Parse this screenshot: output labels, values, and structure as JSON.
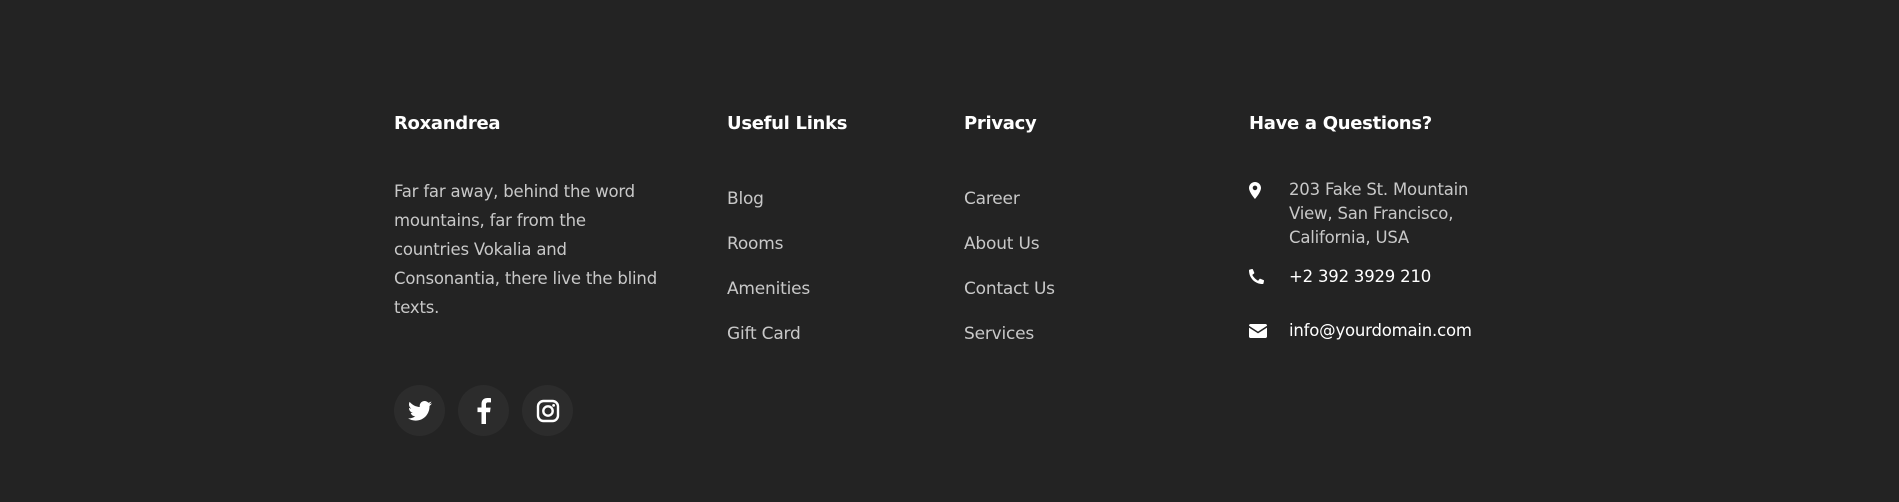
{
  "about": {
    "title": "Roxandrea",
    "text": "Far far away, behind the word mountains, far from the countries Vokalia and Consonantia, there live the blind texts."
  },
  "useful_links": {
    "title": "Useful Links",
    "items": [
      "Blog",
      "Rooms",
      "Amenities",
      "Gift Card"
    ]
  },
  "privacy": {
    "title": "Privacy",
    "items": [
      "Career",
      "About Us",
      "Contact Us",
      "Services"
    ]
  },
  "contact": {
    "title": "Have a Questions?",
    "address": "203 Fake St. Mountain View, San Francisco, California, USA",
    "phone": "+2 392 3929 210",
    "email": "info@yourdomain.com"
  },
  "socials": [
    {
      "icon": "twitter-icon"
    },
    {
      "icon": "facebook-icon"
    },
    {
      "icon": "instagram-icon"
    }
  ]
}
